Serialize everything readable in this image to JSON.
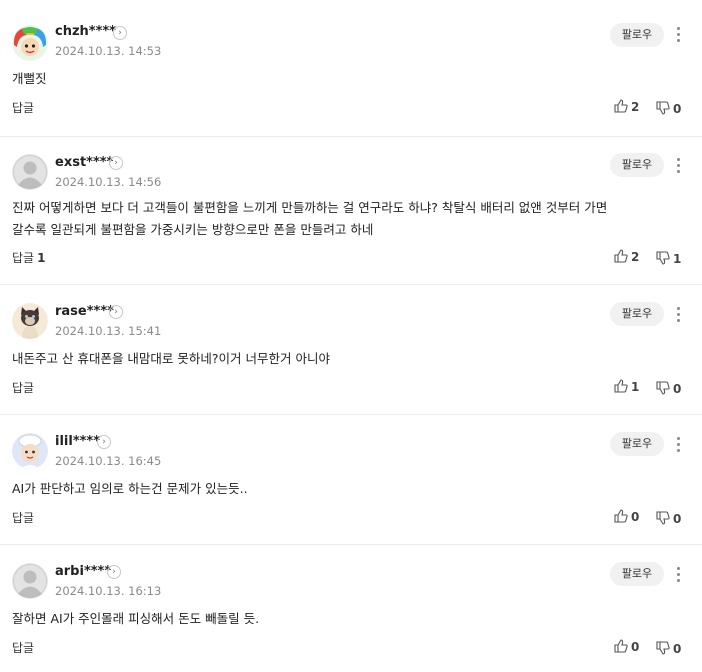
{
  "ui": {
    "follow_label": "팔로우",
    "reply_label": "답글",
    "profile_arrow": "›"
  },
  "comments": [
    {
      "nickname": "chzh****",
      "time": "2024.10.13. 14:53",
      "lines": [
        "개뻘짓"
      ],
      "reply_count": "",
      "likes": "2",
      "dislikes": "0",
      "avatar": "rainbow-hair-avatar"
    },
    {
      "nickname": "exst****",
      "time": "2024.10.13. 14:56",
      "lines": [
        "진짜 어떻게하면 보다 더 고객들이 불편함을 느끼게 만들까하는 걸 연구라도 하냐? 착탈식 배터리 없앤 것부터 가면",
        "갈수록 일관되게 불편함을 가중시키는 방향으로만 폰을 만들려고 하네"
      ],
      "reply_count": "1",
      "likes": "2",
      "dislikes": "1",
      "avatar": "default-avatar"
    },
    {
      "nickname": "rase****",
      "time": "2024.10.13. 15:41",
      "lines": [
        "내돈주고 산 휴대폰을 내맘대로 못하네?이거 너무한거 아니야"
      ],
      "reply_count": "",
      "likes": "1",
      "dislikes": "0",
      "avatar": "cat-avatar"
    },
    {
      "nickname": "ilil****",
      "time": "2024.10.13. 16:45",
      "lines": [
        "AI가 판단하고 임의로 하는건 문제가 있는듯.."
      ],
      "reply_count": "",
      "likes": "0",
      "dislikes": "0",
      "avatar": "chef-avatar"
    },
    {
      "nickname": "arbi****",
      "time": "2024.10.13. 16:13",
      "lines": [
        "잘하면 AI가 주인몰래 피싱해서 돈도 빼돌릴 듯."
      ],
      "reply_count": "",
      "likes": "0",
      "dislikes": "0",
      "avatar": "default-avatar"
    }
  ]
}
